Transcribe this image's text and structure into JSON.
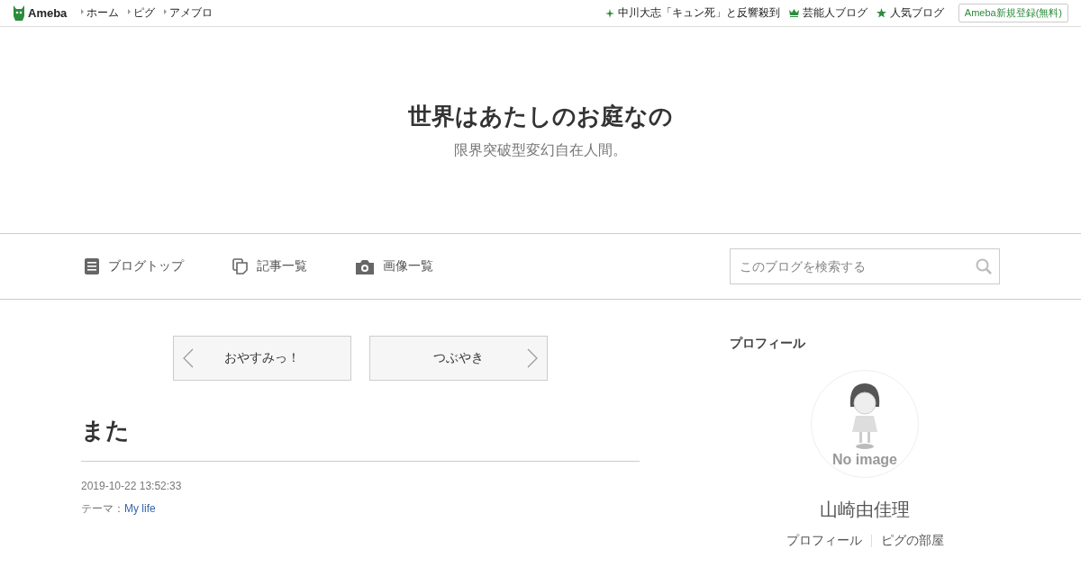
{
  "topbar": {
    "logo": "Ameba",
    "links": [
      "ホーム",
      "ピグ",
      "アメブロ"
    ],
    "right_links": [
      {
        "kind": "sparkle",
        "label": "中川大志「キュン死」と反響殺到"
      },
      {
        "kind": "crown",
        "label": "芸能人ブログ"
      },
      {
        "kind": "star",
        "label": "人気ブログ"
      }
    ],
    "signup": "Ameba新規登録(無料)"
  },
  "header": {
    "title": "世界はあたしのお庭なの",
    "subtitle": "限界突破型変幻自在人間。"
  },
  "nav": {
    "items": [
      {
        "kind": "doc",
        "label": "ブログトップ"
      },
      {
        "kind": "copy",
        "label": "記事一覧"
      },
      {
        "kind": "camera",
        "label": "画像一覧"
      }
    ],
    "search": {
      "placeholder": "このブログを検索する"
    }
  },
  "pager": [
    {
      "kind": "prev",
      "label": "おやすみっ！"
    },
    {
      "kind": "next",
      "label": "つぶやき"
    }
  ],
  "entry": {
    "title": "また",
    "date": "2019-10-22 13:52:33",
    "theme_label": "テーマ：",
    "theme": "My life"
  },
  "profile": {
    "heading": "プロフィール",
    "avatar_text": "No image",
    "name": "山崎由佳理",
    "links": [
      "プロフィール",
      "ピグの部屋"
    ]
  }
}
